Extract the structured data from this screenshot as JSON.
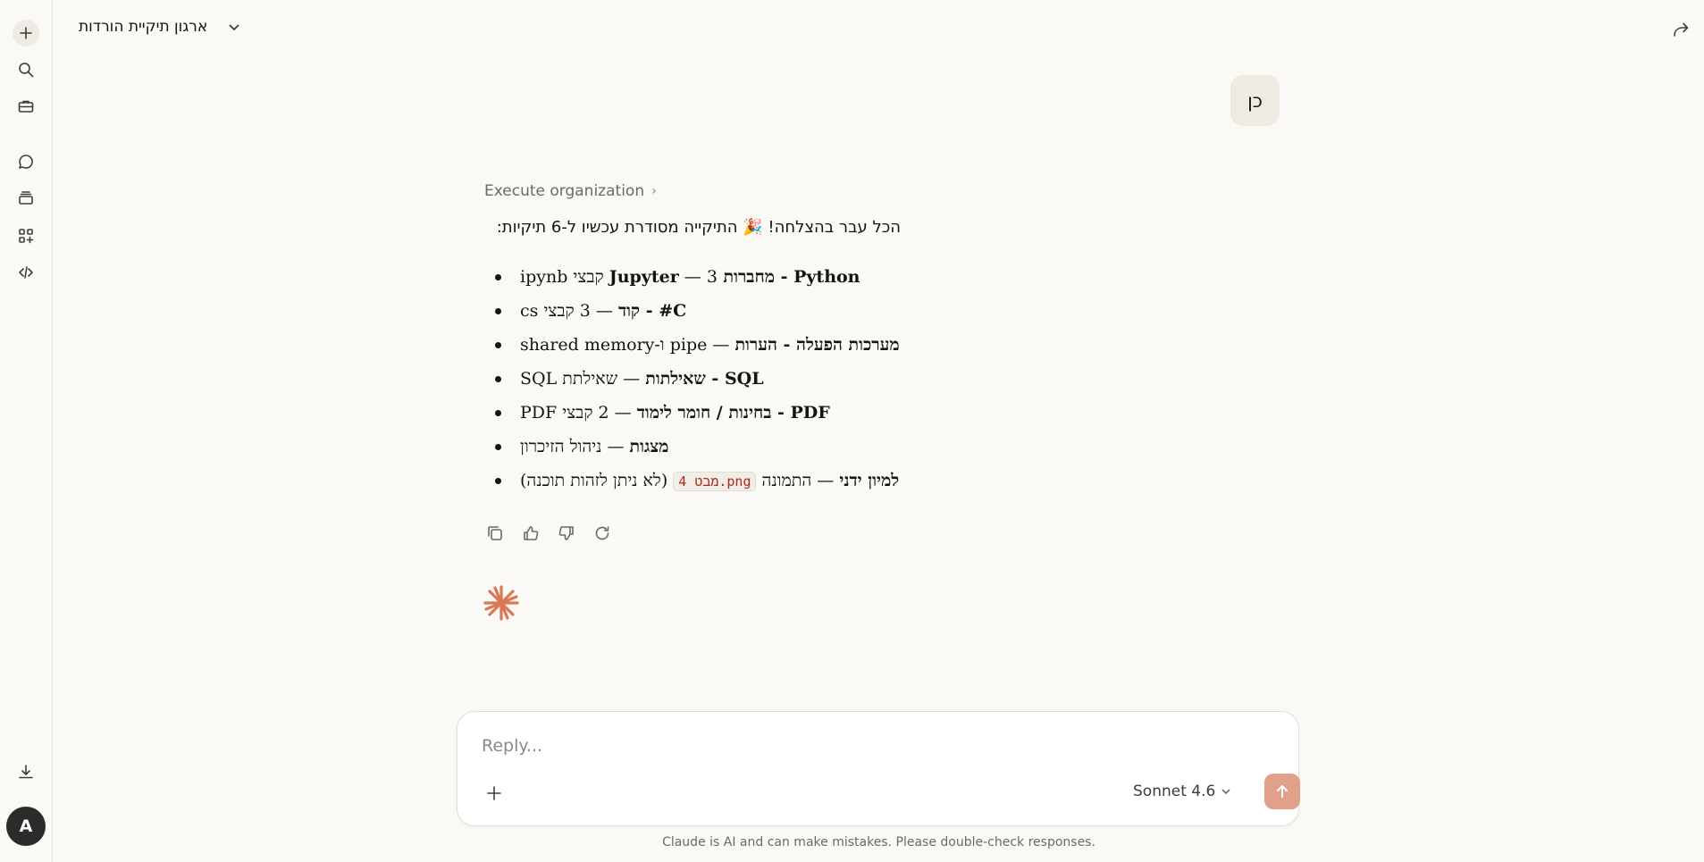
{
  "topbar": {
    "title": "ארגון תיקיית הורדות"
  },
  "sidebar": {
    "new_icon": "plus-icon",
    "search_icon": "search-icon",
    "tools_icon": "briefcase-icon",
    "chats_icon": "chat-icon",
    "projects_icon": "stack-icon",
    "artifacts_icon": "grid-icon",
    "code_icon": "code-icon",
    "download_icon": "download-icon",
    "avatar_initial": "A"
  },
  "conversation": {
    "user_message": "כן",
    "tool_label": "Execute organization",
    "intro": "הכל עבר בהצלחה! 🎉 התיקייה מסודרת עכשיו ל-6 תיקיות:",
    "bullets": [
      {
        "bold": "Python - מחברות Jupyter",
        "rest": " — 3 קבצי ipynb"
      },
      {
        "bold": "C# - קוד",
        "rest": " — 3 קבצי cs"
      },
      {
        "bold": "מערכות הפעלה - הערות",
        "rest": " — pipe ו-shared memory"
      },
      {
        "bold": "SQL - שאילתות",
        "rest": " — שאילתת SQL"
      },
      {
        "bold": "PDF - בחינות / חומר לימוד",
        "rest": " — 2 קבצי PDF"
      },
      {
        "bold": "מצגות",
        "rest": " — ניהול הזיכרון"
      },
      {
        "bold": "למיון ידני",
        "rest": " — התמונה ",
        "code1": "מבט 4",
        "code2": ".png",
        "tail": " (לא ניתן לזהות תוכנה)"
      }
    ]
  },
  "composer": {
    "placeholder": "Reply...",
    "model": "Sonnet 4.6",
    "disclaimer": "Claude is AI and can make mistakes. Please double-check responses."
  },
  "colors": {
    "accent": "#d97757",
    "send": "#e0a08a",
    "background": "#faf9f5"
  }
}
